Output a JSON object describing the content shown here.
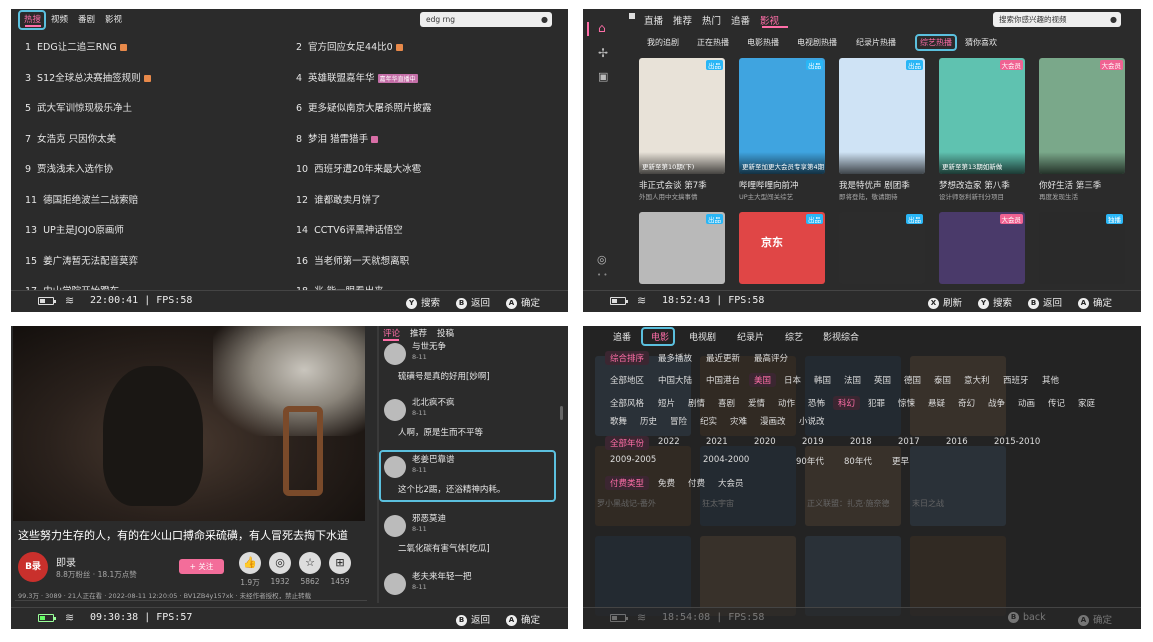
{
  "panel1": {
    "tabs": [
      "热搜",
      "视频",
      "番剧",
      "影视"
    ],
    "search_value": "edg rng",
    "left_items": [
      {
        "rank": "1",
        "text": "EDG让二追三RNG",
        "badge": "hot"
      },
      {
        "rank": "3",
        "text": "S12全球总决赛抽签规则",
        "badge": "hot"
      },
      {
        "rank": "5",
        "text": "武大军训惊现极乐净土",
        "badge": ""
      },
      {
        "rank": "7",
        "text": "女浩克 只因你太美",
        "badge": ""
      },
      {
        "rank": "9",
        "text": "贾浅浅未入选作协",
        "badge": ""
      },
      {
        "rank": "11",
        "text": "德国拒绝波兰二战索赔",
        "badge": ""
      },
      {
        "rank": "13",
        "text": "UP主是JOJO原画师",
        "badge": ""
      },
      {
        "rank": "15",
        "text": "姜广涛暂无法配音莫弈",
        "badge": ""
      },
      {
        "rank": "17",
        "text": "中山学院开始蹬车",
        "badge": ""
      }
    ],
    "right_items": [
      {
        "rank": "2",
        "text": "官方回应女足44比0",
        "badge": "hot"
      },
      {
        "rank": "4",
        "text": "英雄联盟嘉年华",
        "badge": "tag",
        "tag": "嘉年华直播中"
      },
      {
        "rank": "6",
        "text": "更多疑似南京大屠杀照片披露",
        "badge": ""
      },
      {
        "rank": "8",
        "text": "梦泪 猎雷猎手",
        "badge": "pink"
      },
      {
        "rank": "10",
        "text": "西班牙遭20年来最大冰雹",
        "badge": ""
      },
      {
        "rank": "12",
        "text": "谁都敢卖月饼了",
        "badge": ""
      },
      {
        "rank": "14",
        "text": "CCTV6评黑神话悟空",
        "badge": ""
      },
      {
        "rank": "16",
        "text": "当老师第一天就想离职",
        "badge": ""
      },
      {
        "rank": "18",
        "text": "兆·能一眼看出来",
        "badge": ""
      }
    ],
    "status": {
      "time": "22:00:41",
      "fps": "FPS:58"
    },
    "hints": [
      {
        "btn": "Y",
        "label": "搜索"
      },
      {
        "btn": "B",
        "label": "返回"
      },
      {
        "btn": "A",
        "label": "确定"
      }
    ]
  },
  "panel2": {
    "nav": [
      "直播",
      "推荐",
      "热门",
      "追番",
      "影视"
    ],
    "search_placeholder": "搜索你感兴趣的视频",
    "subtabs": [
      "我的追剧",
      "正在热播",
      "电影热播",
      "电视剧热播",
      "纪录片热播",
      "综艺热播",
      "猜你喜欢"
    ],
    "cards": [
      {
        "title": "非正式会谈 第7季",
        "sub": "外国人用中文搞事情",
        "overlay": "更新至第10期(下)",
        "badge": "出品",
        "color": "#e8e2d8"
      },
      {
        "title": "哔哩哔哩向前冲",
        "sub": "UP主大型闯关综艺",
        "overlay": "更新至加更大会员专享第4期",
        "badge": "出品",
        "color": "#3fa4e0"
      },
      {
        "title": "我是特优声 剧团季",
        "sub": "即将登陆，敬请期待",
        "overlay": "",
        "badge": "出品",
        "color": "#cfe3f5"
      },
      {
        "title": "梦想改造家 第八季",
        "sub": "设计师张利新刊分项目",
        "overlay": "更新至第13期如新做",
        "badge": "大会员",
        "color": "#5fc2b0"
      },
      {
        "title": "你好生活 第三季",
        "sub": "再度发现生活",
        "overlay": "",
        "badge": "大会员",
        "color": "#7aa88a"
      }
    ],
    "cards2_badges": [
      "出品",
      "出品",
      "出品",
      "大会员",
      "独播"
    ],
    "card2_texts": [
      "",
      "京东",
      "",
      "",
      ""
    ],
    "status": {
      "time": "18:52:43",
      "fps": "FPS:58"
    },
    "hints": [
      {
        "btn": "X",
        "label": "刷新"
      },
      {
        "btn": "Y",
        "label": "搜索"
      },
      {
        "btn": "B",
        "label": "返回"
      },
      {
        "btn": "A",
        "label": "确定"
      }
    ]
  },
  "panel3": {
    "video_title": "这些努力生存的人，有的在火山口搏命采硫磺，有人冒死去掏下水道",
    "uploader": {
      "name": "即录",
      "stats": "8.8万粉丝 · 18.1万点赞",
      "follow": "+ 关注"
    },
    "actions": [
      {
        "icon": "like-icon",
        "count": "1.9万"
      },
      {
        "icon": "coin-icon",
        "count": "1932"
      },
      {
        "icon": "star-icon",
        "count": "5862"
      },
      {
        "icon": "share-icon",
        "count": "1459"
      }
    ],
    "meta": "99.3万 · 3089 · 21人正在看 · 2022-08-11 12:20:05 · BV1ZB4y157xk · 未经作者授权，禁止转载",
    "tabs": [
      "评论",
      "推荐",
      "投稿"
    ],
    "comments": [
      {
        "name": "与世无争",
        "date": "8-11",
        "text": "硫磺号是真的好用[妙啊]"
      },
      {
        "name": "北北疯不疯",
        "date": "8-11",
        "text": "人啊，原是生而不平等"
      },
      {
        "name": "老姜巴靠谱",
        "date": "8-11",
        "text": "这个比2踢，还浴精神内耗。"
      },
      {
        "name": "邪恶莫迪",
        "date": "8-11",
        "text": "二氧化碳有害气体[吃瓜]"
      },
      {
        "name": "老夫来年轻一把",
        "date": "8-11",
        "text": ""
      }
    ],
    "status": {
      "time": "09:30:38",
      "fps": "FPS:57"
    },
    "hints": [
      {
        "btn": "B",
        "label": "返回"
      },
      {
        "btn": "A",
        "label": "确定"
      }
    ]
  },
  "panel4": {
    "nav": [
      "追番",
      "电影",
      "电视剧",
      "纪录片",
      "综艺",
      "影视综合"
    ],
    "sort": [
      "综合排序",
      "最多播放",
      "最近更新",
      "最高评分"
    ],
    "regions": [
      "全部地区",
      "中国大陆",
      "中国港台",
      "美国",
      "日本",
      "韩国",
      "法国",
      "英国",
      "德国",
      "泰国",
      "意大利",
      "西班牙",
      "其他"
    ],
    "styles": [
      "全部风格",
      "短片",
      "剧情",
      "喜剧",
      "爱情",
      "动作",
      "恐怖",
      "科幻",
      "犯罪",
      "惊悚",
      "悬疑",
      "奇幻",
      "战争",
      "动画",
      "传记",
      "家庭",
      "歌舞",
      "历史",
      "冒险",
      "纪实",
      "灾难",
      "漫画改",
      "小说改"
    ],
    "years": [
      "全部年份",
      "2022",
      "2021",
      "2020",
      "2019",
      "2018",
      "2017",
      "2016",
      "2015-2010",
      "2009-2005",
      "2004-2000",
      "90年代",
      "80年代",
      "更早"
    ],
    "pay": [
      "付费类型",
      "免费",
      "付费",
      "大会员"
    ],
    "bg_titles": [
      "罗小黑战记-番外",
      "狂太宇宙",
      "正义联盟：扎克·施奈德",
      "末日之战"
    ],
    "status": {
      "time": "18:54:08",
      "fps": "FPS:58"
    },
    "hints": [
      {
        "btn": "B",
        "label": "back"
      },
      {
        "btn": "A",
        "label": "确定"
      }
    ]
  }
}
